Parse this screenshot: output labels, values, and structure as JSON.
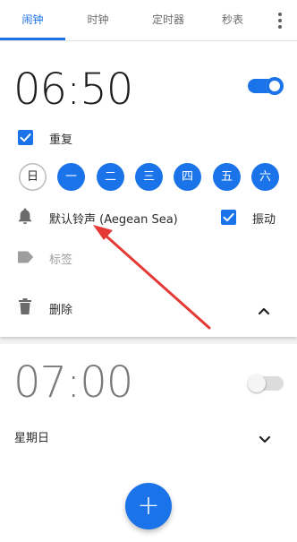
{
  "tabs": [
    {
      "label": "闹钟",
      "active": true
    },
    {
      "label": "时钟",
      "active": false
    },
    {
      "label": "定时器",
      "active": false
    },
    {
      "label": "秒表",
      "active": false
    }
  ],
  "accent_color": "#1a73e8",
  "alarm1": {
    "time": "06:50",
    "enabled": true,
    "repeat_label": "重复",
    "repeat_checked": true,
    "days": [
      {
        "label": "日",
        "selected": false
      },
      {
        "label": "一",
        "selected": true
      },
      {
        "label": "二",
        "selected": true
      },
      {
        "label": "三",
        "selected": true
      },
      {
        "label": "四",
        "selected": true
      },
      {
        "label": "五",
        "selected": true
      },
      {
        "label": "六",
        "selected": true
      }
    ],
    "ringtone": "默认铃声 (Aegean Sea)",
    "vibrate_label": "振动",
    "vibrate_checked": true,
    "tag_placeholder": "标签",
    "delete_label": "删除"
  },
  "alarm2": {
    "time": "07:00",
    "enabled": false,
    "repeat_text": "星期日"
  },
  "fab_symbol": "+",
  "annotation_color": "#e53935"
}
